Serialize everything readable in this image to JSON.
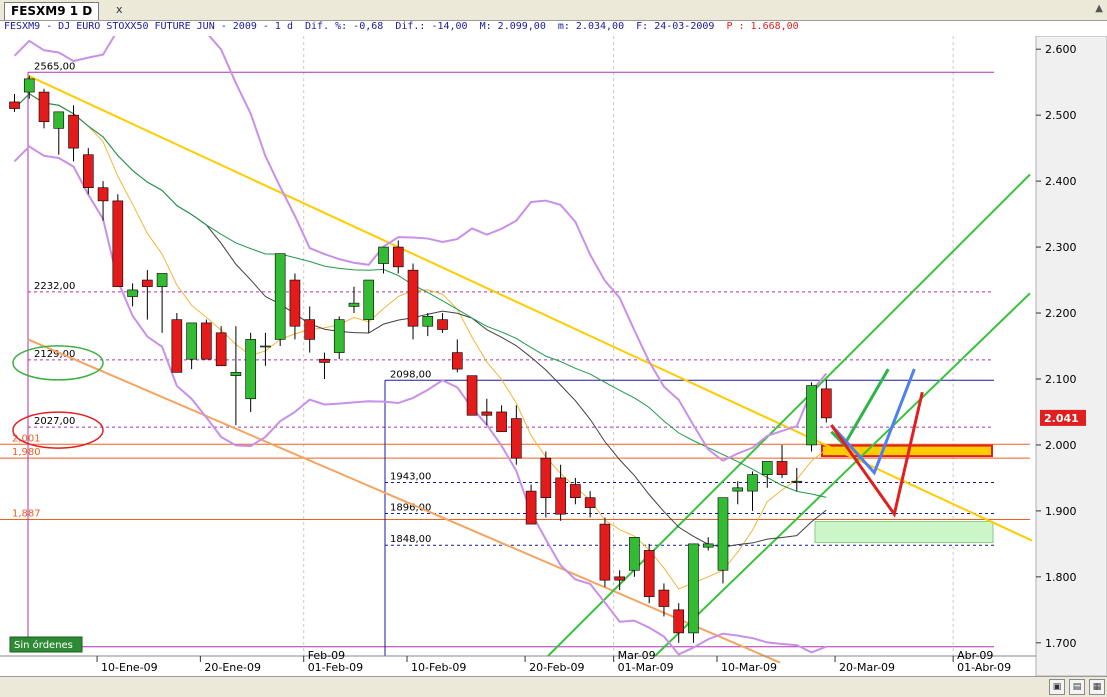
{
  "window": {
    "tab_title": "FESXM9 1 D",
    "close_label": "x"
  },
  "infobar": {
    "symbol": "FESXM9 - DJ EURO STOXX50 FUTURE  JUN - 2009 - 1 d",
    "dif_pct": "Dif. %: -0,68",
    "dif": "Dif.: -14,00",
    "max": "M: 2.099,00",
    "min": "m: 2.034,00",
    "date": "F: 24-03-2009",
    "pnl": "P : 1.668,00"
  },
  "colors": {
    "up": "#33bb33",
    "down": "#e31b1b",
    "resistance": "#b030b0",
    "support": "#1a1aa0",
    "trend_yellow": "#ffcc00",
    "trend_orange": "#f4a460",
    "channel": "#39c23c",
    "bollinger": "#c890e8",
    "last_price_bg": "#e02020",
    "future_red": "#e02020",
    "future_green": "#2db54a",
    "future_blue": "#4f7ff0"
  },
  "chart_data": {
    "type": "candlestick",
    "ylim": [
      1680,
      2620
    ],
    "yticks": [
      "2.600",
      "2.500",
      "2.400",
      "2.300",
      "2.200",
      "2.100",
      "2.000",
      "1.900",
      "1.800",
      "1.700"
    ],
    "ytick_values": [
      2600,
      2500,
      2400,
      2300,
      2200,
      2100,
      2000,
      1900,
      1800,
      1700
    ],
    "xticks": [
      {
        "label": "10-Ene-09",
        "bar": 6
      },
      {
        "label": "20-Ene-09",
        "bar": 13
      },
      {
        "label": "01-Feb-09",
        "bar": 20
      },
      {
        "label": "10-Feb-09",
        "bar": 27
      },
      {
        "label": "20-Feb-09",
        "bar": 35
      },
      {
        "label": "01-Mar-09",
        "bar": 41
      },
      {
        "label": "10-Mar-09",
        "bar": 48
      },
      {
        "label": "20-Mar-09",
        "bar": 56
      },
      {
        "label": "01-Abr-09",
        "bar": 64
      }
    ],
    "month_labels": [
      {
        "label": "Feb-09",
        "bar": 20
      },
      {
        "label": "Mar-09",
        "bar": 41
      },
      {
        "label": "Abr-09",
        "bar": 64
      }
    ],
    "candles": [
      [
        2520,
        2532,
        2505,
        2510
      ],
      [
        2535,
        2560,
        2525,
        2555
      ],
      [
        2535,
        2540,
        2480,
        2490
      ],
      [
        2480,
        2500,
        2440,
        2505
      ],
      [
        2500,
        2515,
        2430,
        2450
      ],
      [
        2440,
        2450,
        2380,
        2390
      ],
      [
        2390,
        2400,
        2340,
        2370
      ],
      [
        2370,
        2380,
        2240,
        2240
      ],
      [
        2225,
        2245,
        2210,
        2235
      ],
      [
        2250,
        2265,
        2190,
        2240
      ],
      [
        2240,
        2260,
        2170,
        2260
      ],
      [
        2190,
        2200,
        2110,
        2110
      ],
      [
        2130,
        2185,
        2115,
        2185
      ],
      [
        2185,
        2190,
        2130,
        2130
      ],
      [
        2170,
        2180,
        2120,
        2120
      ],
      [
        2105,
        2180,
        2030,
        2110
      ],
      [
        2070,
        2170,
        2050,
        2160
      ],
      [
        2150,
        2170,
        2120,
        2150
      ],
      [
        2160,
        2290,
        2150,
        2290
      ],
      [
        2250,
        2260,
        2160,
        2180
      ],
      [
        2190,
        2210,
        2140,
        2160
      ],
      [
        2130,
        2140,
        2100,
        2125
      ],
      [
        2140,
        2195,
        2130,
        2190
      ],
      [
        2210,
        2240,
        2200,
        2215
      ],
      [
        2190,
        2250,
        2170,
        2250
      ],
      [
        2275,
        2300,
        2260,
        2300
      ],
      [
        2300,
        2310,
        2260,
        2270
      ],
      [
        2265,
        2275,
        2160,
        2180
      ],
      [
        2180,
        2200,
        2165,
        2195
      ],
      [
        2190,
        2200,
        2170,
        2175
      ],
      [
        2140,
        2160,
        2110,
        2115
      ],
      [
        2105,
        2080,
        2050,
        2045
      ],
      [
        2050,
        2070,
        2030,
        2045
      ],
      [
        2050,
        2060,
        2020,
        2020
      ],
      [
        2040,
        2060,
        1970,
        1980
      ],
      [
        1930,
        1940,
        1880,
        1880
      ],
      [
        1980,
        1990,
        1890,
        1920
      ],
      [
        1950,
        1970,
        1885,
        1895
      ],
      [
        1940,
        1950,
        1910,
        1920
      ],
      [
        1920,
        1930,
        1890,
        1905
      ],
      [
        1880,
        1890,
        1785,
        1795
      ],
      [
        1800,
        1810,
        1780,
        1795
      ],
      [
        1810,
        1860,
        1800,
        1860
      ],
      [
        1840,
        1850,
        1760,
        1770
      ],
      [
        1780,
        1790,
        1740,
        1755
      ],
      [
        1750,
        1760,
        1700,
        1715
      ],
      [
        1715,
        1850,
        1700,
        1850
      ],
      [
        1845,
        1860,
        1840,
        1850
      ],
      [
        1810,
        1920,
        1790,
        1920
      ],
      [
        1930,
        1945,
        1910,
        1935
      ],
      [
        1930,
        1960,
        1900,
        1955
      ],
      [
        1955,
        1975,
        1935,
        1975
      ],
      [
        1975,
        2000,
        1950,
        1955
      ],
      [
        1945,
        1965,
        1930,
        1945
      ],
      [
        2000,
        2095,
        1990,
        2090
      ],
      [
        2085,
        2099,
        2034,
        2041
      ]
    ],
    "levels": [
      {
        "label": "2565,00",
        "value": 2565,
        "color": "#b030b0",
        "style": "solid"
      },
      {
        "label": "2232,00",
        "value": 2232,
        "color": "#b030b0",
        "style": "dash"
      },
      {
        "label": "2129,00",
        "value": 2129,
        "color": "#b030b0",
        "style": "dash"
      },
      {
        "label": "2098,00",
        "value": 2098,
        "color": "#1a1aa0",
        "style": "solid"
      },
      {
        "label": "2027,00",
        "value": 2027,
        "color": "#b030b0",
        "style": "dash"
      },
      {
        "label": "2,001",
        "value": 2001,
        "color": "#f06020",
        "style": "solid"
      },
      {
        "label": "1,980",
        "value": 1980,
        "color": "#f06020",
        "style": "solid"
      },
      {
        "label": "1943,00",
        "value": 1943,
        "color": "#1a1aa0",
        "style": "dash"
      },
      {
        "label": "1896,00",
        "value": 1896,
        "color": "#1a1aa0",
        "style": "dash"
      },
      {
        "label": "1,887",
        "value": 1887,
        "color": "#f06020",
        "style": "solid"
      },
      {
        "label": "1848,00",
        "value": 1848,
        "color": "#1a1aa0",
        "style": "dash"
      },
      {
        "label": "1694,00",
        "value": 1694,
        "color": "#b030b0",
        "style": "solid"
      }
    ],
    "last_price_label": "2.041",
    "last_price": 2041
  },
  "sin_ordenes_label": "Sin órdenes",
  "toolbar": {
    "icon_1": "chart-icon",
    "icon_2": "print-icon",
    "icon_3": "zoom-icon"
  }
}
